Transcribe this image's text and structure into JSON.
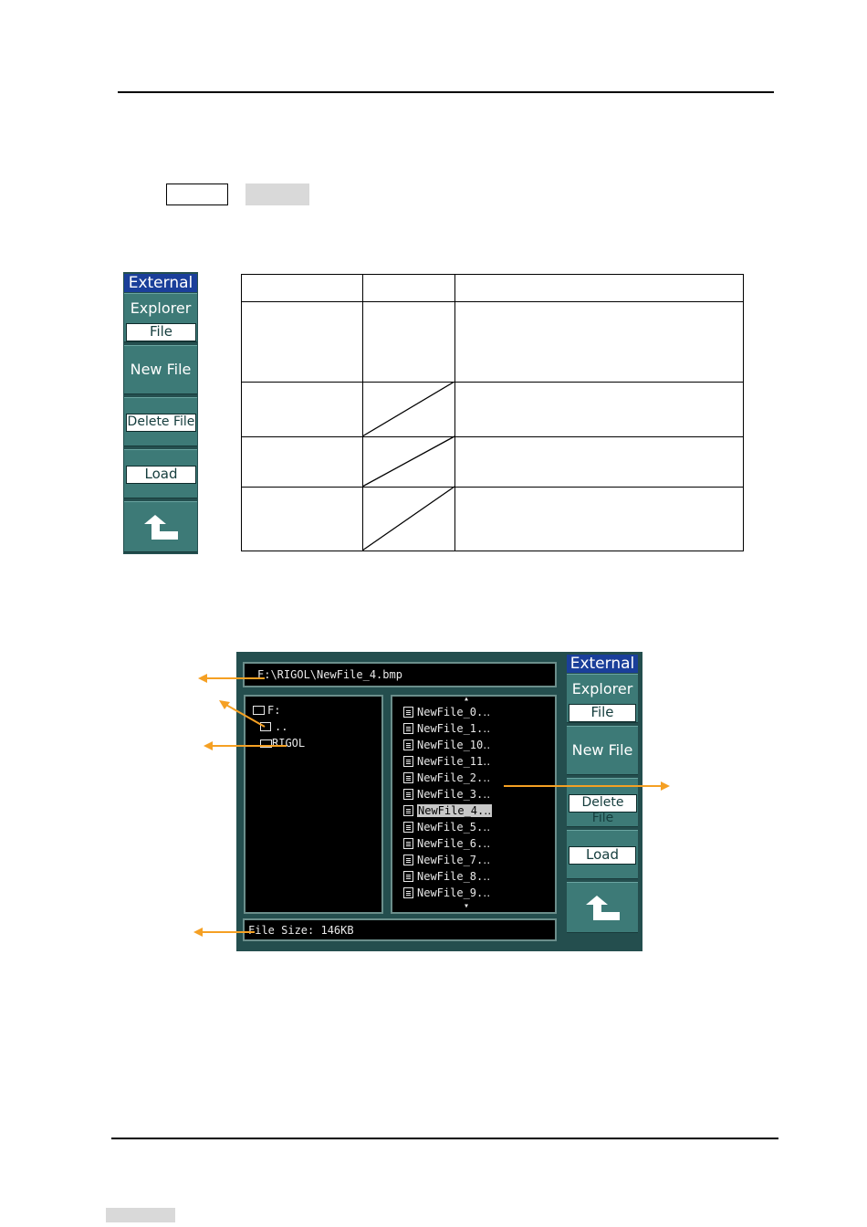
{
  "menu_small": {
    "title": "External",
    "explorer_label": "Explorer",
    "explorer_value": "File",
    "new_file_label": "New File",
    "delete_file_label": "Delete File",
    "load_label": "Load"
  },
  "explorer_screen": {
    "path": "F:\\RIGOL\\NewFile_4.bmp",
    "tree": {
      "drive": "F:",
      "parent": "..",
      "folder": "RIGOL"
    },
    "files": [
      "NewFile_0.‥",
      "NewFile_1.‥",
      "NewFile_10‥",
      "NewFile_11‥",
      "NewFile_2.‥",
      "NewFile_3.‥",
      "NewFile_4.‥",
      "NewFile_5.‥",
      "NewFile_6.‥",
      "NewFile_7.‥",
      "NewFile_8.‥",
      "NewFile_9.‥"
    ],
    "selected_index": 6,
    "scroll_up": "▴",
    "scroll_down": "▾",
    "file_size": "File Size: 146KB",
    "menu": {
      "title": "External",
      "explorer_label": "Explorer",
      "explorer_value": "File",
      "new_file_label": "New File",
      "delete_file_label": "Delete File",
      "load_label": "Load"
    }
  },
  "colors": {
    "accent_arrow": "#f5a023",
    "menu_title_bg": "#1a3f9a",
    "menu_button_bg": "#3d7a77",
    "screen_bg": "#244e4e"
  },
  "icons": {
    "back": "return-arrow-icon"
  }
}
